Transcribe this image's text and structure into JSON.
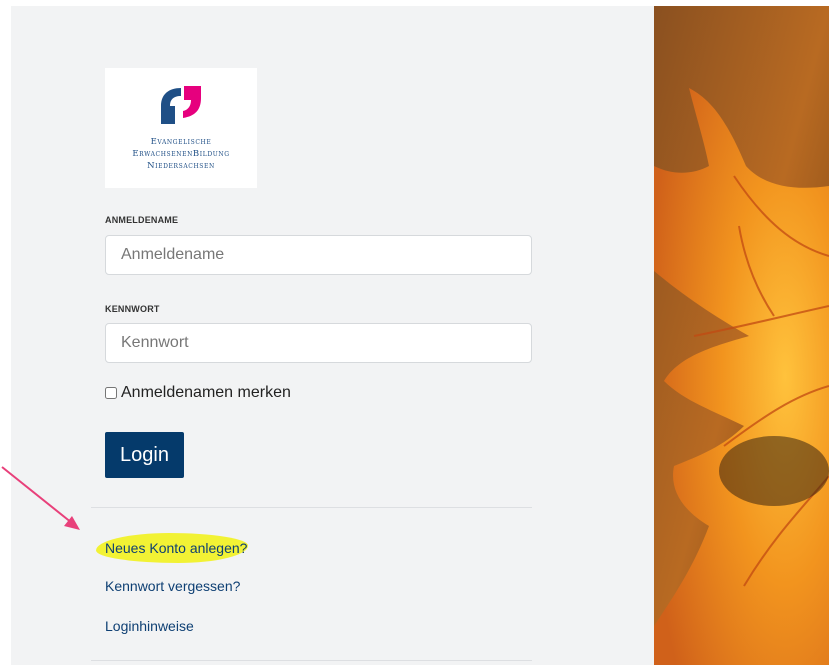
{
  "logo": {
    "line1": "Evangelische",
    "line2": "ErwachsenenBildung",
    "line3": "Niedersachsen"
  },
  "login_form": {
    "username_label": "ANMELDENAME",
    "username_placeholder": "Anmeldename",
    "username_value": "",
    "password_label": "KENNWORT",
    "password_placeholder": "Kennwort",
    "password_value": "",
    "remember_label": "Anmeldenamen merken",
    "remember_checked": false,
    "login_button": "Login"
  },
  "links": {
    "new_account": "Neues Konto anlegen?",
    "forgot_password": "Kennwort vergessen?",
    "login_hints": "Loginhinweise"
  },
  "colors": {
    "panel_bg": "#f2f3f4",
    "button_bg": "#053a6b",
    "link_color": "#0e3f73",
    "logo_blue": "#1f4f86",
    "logo_pink": "#e6007e",
    "highlight": "#f2f21f",
    "arrow": "#e8407a"
  },
  "icons": {
    "logo": "ebn-logo-icon",
    "annotation": "arrow-annotation-icon",
    "background": "autumn-leaf-image"
  }
}
